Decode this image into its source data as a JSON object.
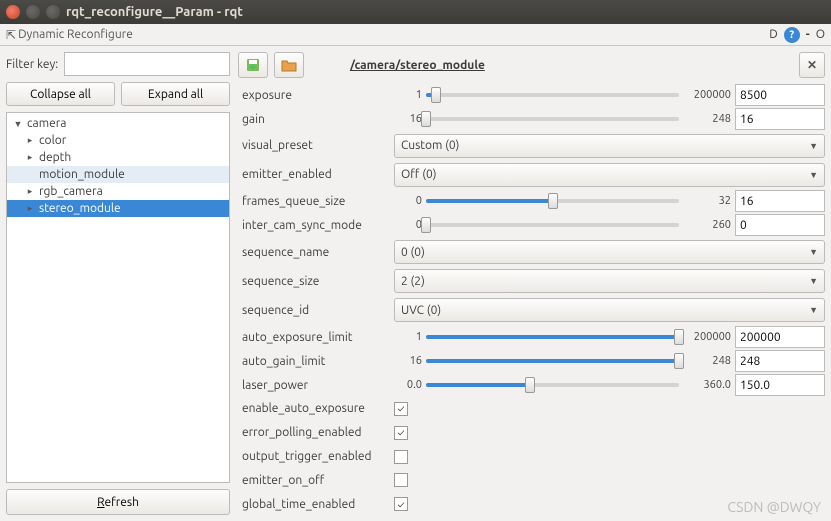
{
  "window": {
    "title": "rqt_reconfigure__Param - rqt"
  },
  "panel_title": "Dynamic Reconfigure",
  "header_right": {
    "d_label": "D",
    "minus": "-",
    "circle": "O"
  },
  "filter": {
    "label": "Filter key:",
    "value": ""
  },
  "buttons": {
    "collapse": "Collapse all",
    "expand": "Expand all",
    "refresh": "Refresh"
  },
  "tree": {
    "root": "camera",
    "items": [
      {
        "label": "color",
        "expandable": true
      },
      {
        "label": "depth",
        "expandable": true
      },
      {
        "label": "motion_module",
        "expandable": false,
        "highlighted": true
      },
      {
        "label": "rgb_camera",
        "expandable": true
      },
      {
        "label": "stereo_module",
        "expandable": true,
        "selected": true
      }
    ]
  },
  "node_path": "/camera/stereo_module",
  "params": [
    {
      "type": "slider",
      "name": "exposure",
      "min": "1",
      "max": "200000",
      "value": "8500",
      "fill": 4
    },
    {
      "type": "slider",
      "name": "gain",
      "min": "16",
      "max": "248",
      "value": "16",
      "fill": 0
    },
    {
      "type": "dropdown",
      "name": "visual_preset",
      "value": "Custom (0)",
      "tall": true
    },
    {
      "type": "dropdown",
      "name": "emitter_enabled",
      "value": "Off (0)",
      "tall": true
    },
    {
      "type": "slider",
      "name": "frames_queue_size",
      "min": "0",
      "max": "32",
      "value": "16",
      "fill": 50
    },
    {
      "type": "slider",
      "name": "inter_cam_sync_mode",
      "min": "0",
      "max": "260",
      "value": "0",
      "fill": 0
    },
    {
      "type": "dropdown",
      "name": "sequence_name",
      "value": "0 (0)",
      "tall": true
    },
    {
      "type": "dropdown",
      "name": "sequence_size",
      "value": "2 (2)",
      "tall": true
    },
    {
      "type": "dropdown",
      "name": "sequence_id",
      "value": "UVC (0)",
      "tall": true
    },
    {
      "type": "slider",
      "name": "auto_exposure_limit",
      "min": "1",
      "max": "200000",
      "value": "200000",
      "fill": 100
    },
    {
      "type": "slider",
      "name": "auto_gain_limit",
      "min": "16",
      "max": "248",
      "value": "248",
      "fill": 100
    },
    {
      "type": "slider",
      "name": "laser_power",
      "min": "0.0",
      "max": "360.0",
      "value": "150.0",
      "fill": 41
    },
    {
      "type": "check",
      "name": "enable_auto_exposure",
      "checked": true
    },
    {
      "type": "check",
      "name": "error_polling_enabled",
      "checked": true
    },
    {
      "type": "check",
      "name": "output_trigger_enabled",
      "checked": false
    },
    {
      "type": "check",
      "name": "emitter_on_off",
      "checked": false
    },
    {
      "type": "check",
      "name": "global_time_enabled",
      "checked": true
    }
  ],
  "watermark": "CSDN @DWQY"
}
